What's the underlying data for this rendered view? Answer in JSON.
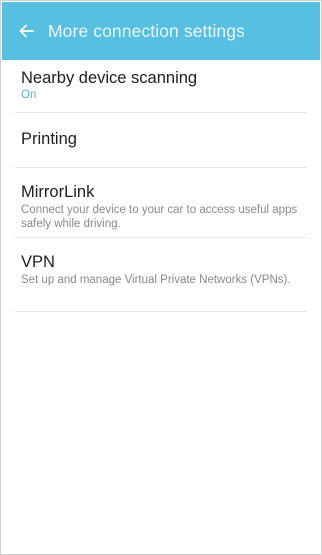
{
  "app_bar": {
    "title": "More connection settings",
    "back_icon": "arrow-left-icon",
    "background_color": "#56bfe2"
  },
  "settings": [
    {
      "label": "Nearby device scanning",
      "summary": "On",
      "summary_color": "#56b4d8"
    },
    {
      "label": "Printing"
    },
    {
      "label": "MirrorLink",
      "summary": "Connect your device to your car to access useful apps safely while driving."
    },
    {
      "label": "VPN",
      "summary": "Set up and manage Virtual Private Networks (VPNs)."
    }
  ]
}
